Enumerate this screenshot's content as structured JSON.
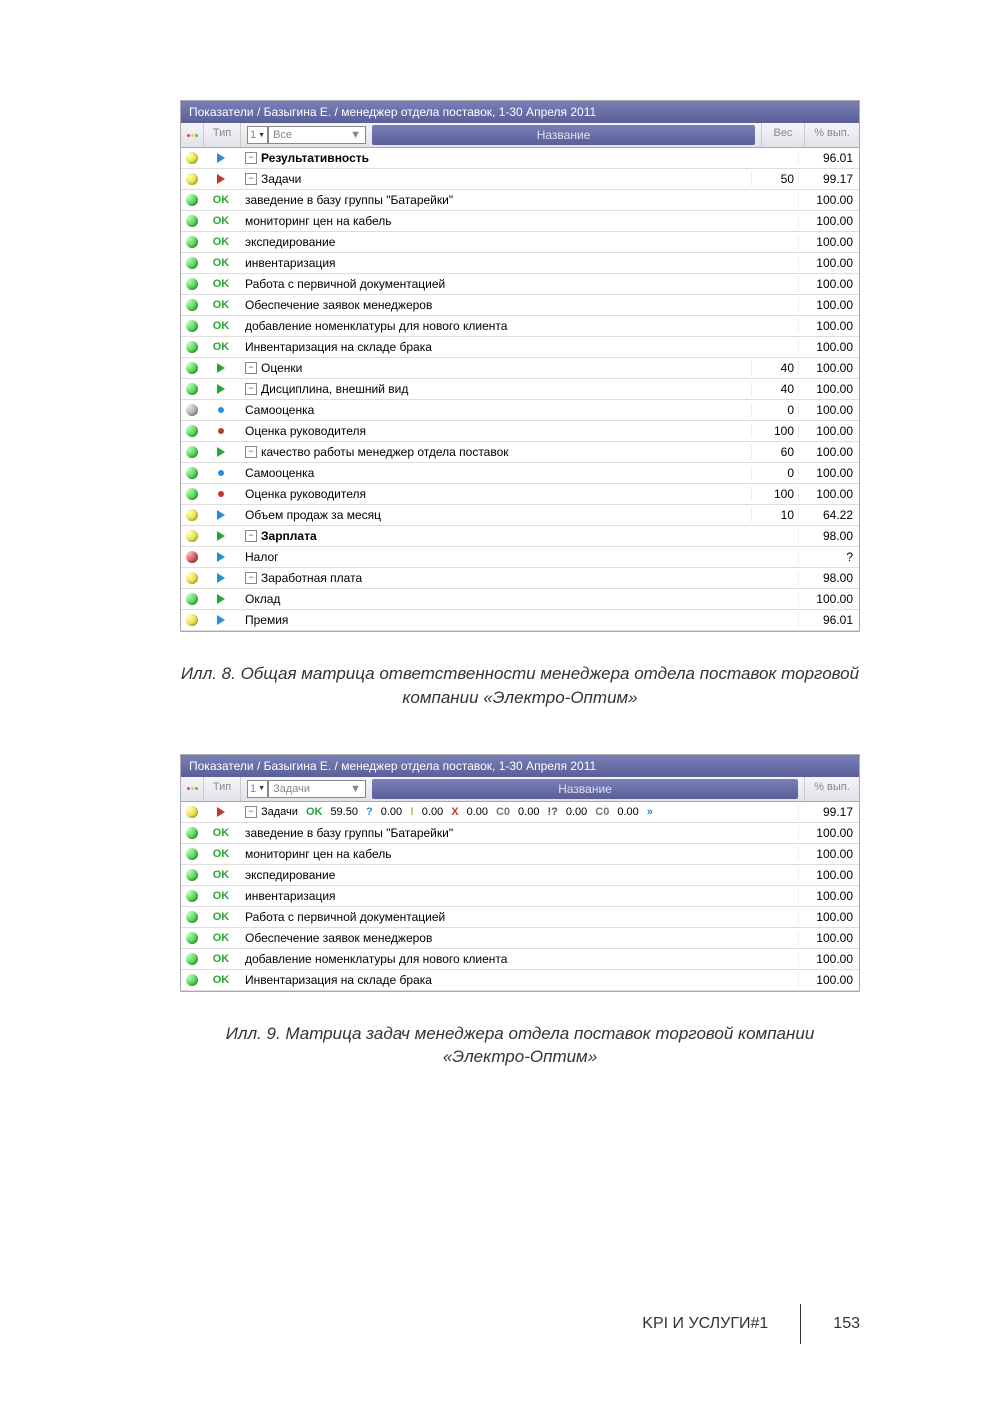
{
  "panel1": {
    "title": "Показатели / Базыгина Е. / менеджер отдела поставок, 1-30 Апреля 2011",
    "headers": {
      "type": "Тип",
      "spinValue": "1",
      "filter": "Все",
      "name": "Название",
      "weight": "Вес",
      "pct": "% вып."
    },
    "rows": [
      {
        "ball": "yellow",
        "type": "tri-blue",
        "indent": 2,
        "toggle": true,
        "bold": true,
        "name": "Результативность",
        "weight": "",
        "pct": "96.01"
      },
      {
        "ball": "yellow",
        "type": "tri-red",
        "indent": 3,
        "toggle": true,
        "name": "Задачи",
        "weight": "50",
        "pct": "99.17"
      },
      {
        "ball": "green",
        "type": "ok",
        "indent": 4,
        "name": "заведение в базу группы \"Батарейки\"",
        "weight": "",
        "pct": "100.00"
      },
      {
        "ball": "green",
        "type": "ok",
        "indent": 4,
        "name": "мониторинг цен на кабель",
        "weight": "",
        "pct": "100.00"
      },
      {
        "ball": "green",
        "type": "ok",
        "indent": 4,
        "name": "экспедирование",
        "weight": "",
        "pct": "100.00"
      },
      {
        "ball": "green",
        "type": "ok",
        "indent": 4,
        "name": "инвентаризация",
        "weight": "",
        "pct": "100.00"
      },
      {
        "ball": "green",
        "type": "ok",
        "indent": 4,
        "name": "Работа с первичной документацией",
        "weight": "",
        "pct": "100.00"
      },
      {
        "ball": "green",
        "type": "ok",
        "indent": 4,
        "name": "Обеспечение заявок менеджеров",
        "weight": "",
        "pct": "100.00"
      },
      {
        "ball": "green",
        "type": "ok",
        "indent": 4,
        "name": "добавление номенклатуры для нового клиента",
        "weight": "",
        "pct": "100.00"
      },
      {
        "ball": "green",
        "type": "ok",
        "indent": 4,
        "name": "Инвентаризация на складе брака",
        "weight": "",
        "pct": "100.00"
      },
      {
        "ball": "green",
        "type": "tri-green",
        "indent": 3,
        "toggle": true,
        "name": "Оценки",
        "weight": "40",
        "pct": "100.00"
      },
      {
        "ball": "green",
        "type": "tri-green",
        "indent": 4,
        "toggle": true,
        "name": "Дисциплина, внешний вид",
        "weight": "40",
        "pct": "100.00"
      },
      {
        "ball": "gray",
        "type": "dot-blue",
        "indent": 5,
        "name": "Самооценка",
        "weight": "0",
        "pct": "100.00"
      },
      {
        "ball": "green",
        "type": "dot-red",
        "indent": 5,
        "name": "Оценка руководителя",
        "weight": "100",
        "pct": "100.00"
      },
      {
        "ball": "green",
        "type": "tri-green",
        "indent": 4,
        "toggle": true,
        "name": "качество работы менеджер отдела поставок",
        "weight": "60",
        "pct": "100.00"
      },
      {
        "ball": "green",
        "type": "dot-blue",
        "indent": 5,
        "name": "Самооценка",
        "weight": "0",
        "pct": "100.00"
      },
      {
        "ball": "green",
        "type": "dot-red",
        "indent": 5,
        "name": "Оценка руководителя",
        "weight": "100",
        "pct": "100.00"
      },
      {
        "ball": "yellow",
        "type": "tri-blue",
        "indent": 3,
        "name": "Объем продаж за месяц",
        "weight": "10",
        "pct": "64.22"
      },
      {
        "ball": "yellow",
        "type": "tri-green",
        "indent": 2,
        "toggle": true,
        "bold": true,
        "name": "Зарплата",
        "weight": "",
        "pct": "98.00"
      },
      {
        "ball": "red",
        "type": "tri-blue",
        "indent": 3,
        "name": "Налог",
        "weight": "",
        "pct": "?"
      },
      {
        "ball": "yellow",
        "type": "tri-blue",
        "indent": 3,
        "toggle": true,
        "name": "Заработная плата",
        "weight": "",
        "pct": "98.00"
      },
      {
        "ball": "green",
        "type": "tri-green",
        "indent": 4,
        "name": "Оклад",
        "weight": "",
        "pct": "100.00"
      },
      {
        "ball": "yellow",
        "type": "tri-blue",
        "indent": 4,
        "name": "Премия",
        "weight": "",
        "pct": "96.01"
      }
    ]
  },
  "caption1": "Илл. 8. Общая матрица ответственности менеджера отдела поставок торговой компании «Электро-Оптим»",
  "panel2": {
    "title": "Показатели / Базыгина Е. / менеджер отдела поставок, 1-30 Апреля 2011",
    "headers": {
      "type": "Тип",
      "spinValue": "1",
      "filter": "Задачи",
      "name": "Название",
      "pct": "% вып."
    },
    "summary": {
      "label": "Задачи",
      "ok": "OK",
      "okVal": "59.50",
      "q": "?",
      "qVal": "0.00",
      "ex": "!",
      "exVal": "0.00",
      "x": "X",
      "xVal": "0.00",
      "c0": "C0",
      "c0Val": "0.00",
      "iq": "!?",
      "iqVal": "0.00",
      "c0b": "C0",
      "c0bVal": "0.00",
      "more": "»",
      "pct": "99.17"
    },
    "rows": [
      {
        "ball": "green",
        "type": "ok",
        "indent": 4,
        "name": "заведение в базу группы \"Батарейки\"",
        "pct": "100.00"
      },
      {
        "ball": "green",
        "type": "ok",
        "indent": 4,
        "name": "мониторинг цен на кабель",
        "pct": "100.00"
      },
      {
        "ball": "green",
        "type": "ok",
        "indent": 4,
        "name": "экспедирование",
        "pct": "100.00"
      },
      {
        "ball": "green",
        "type": "ok",
        "indent": 4,
        "name": "инвентаризация",
        "pct": "100.00"
      },
      {
        "ball": "green",
        "type": "ok",
        "indent": 4,
        "name": "Работа с первичной документацией",
        "pct": "100.00"
      },
      {
        "ball": "green",
        "type": "ok",
        "indent": 4,
        "name": "Обеспечение заявок менеджеров",
        "pct": "100.00"
      },
      {
        "ball": "green",
        "type": "ok",
        "indent": 4,
        "name": "добавление номенклатуры для нового клиента",
        "pct": "100.00"
      },
      {
        "ball": "green",
        "type": "ok",
        "indent": 4,
        "name": "Инвентаризация на складе брака",
        "pct": "100.00"
      }
    ]
  },
  "caption2": "Илл. 9. Матрица задач менеджера отдела поставок торговой компании «Электро-Оптим»",
  "footer": {
    "section": "KPI И УСЛУГИ#1",
    "page": "153"
  }
}
